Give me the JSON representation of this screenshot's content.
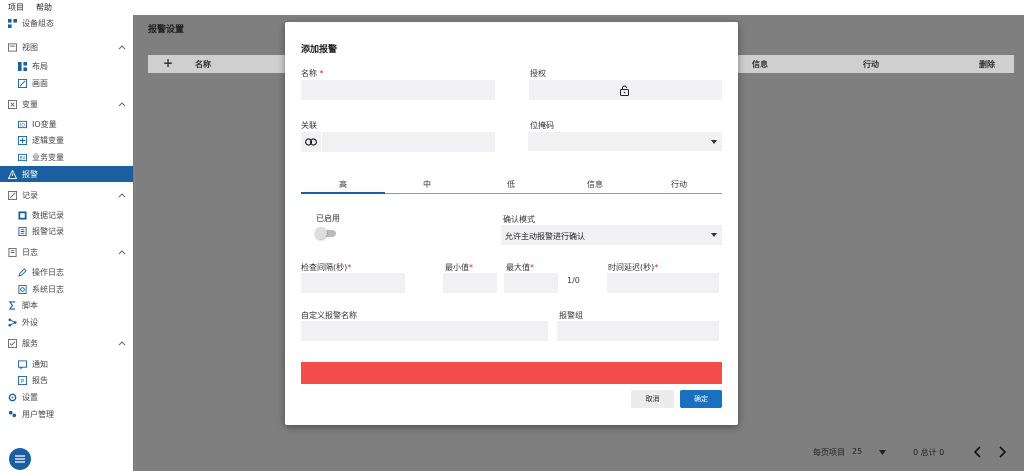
{
  "menubar": {
    "items": [
      "项目",
      "帮助"
    ]
  },
  "sidebar": {
    "device_config": "设备组态",
    "view": "视图",
    "layout": "布局",
    "canvas": "画面",
    "variables": "变量",
    "io_vars": "IO变量",
    "logic_vars": "逻辑变量",
    "business_vars": "业务变量",
    "alarm": "报警",
    "records": "记录",
    "data_records": "数据记录",
    "alarm_records": "报警记录",
    "logs": "日志",
    "op_logs": "操作日志",
    "sys_logs": "系统日志",
    "script": "脚本",
    "peripherals": "外设",
    "services": "服务",
    "notify": "通知",
    "report": "报告",
    "settings": "设置",
    "user_mgmt": "用户管理"
  },
  "main": {
    "title": "报警设置",
    "add_glyph": "+",
    "columns": [
      "名称",
      "信息",
      "行动",
      "删除"
    ],
    "per_page_label": "每页项目",
    "per_page_value": "25",
    "range": "0 总计 0"
  },
  "modal": {
    "title": "添加报警",
    "name_label": "名称",
    "required_mark": "*",
    "auth_label": "授权",
    "link_label": "关联",
    "bitmask_label": "位掩码",
    "tabs": [
      "高",
      "中",
      "低",
      "信息",
      "行动"
    ],
    "enabled_label": "已启用",
    "ack_mode_label": "确认模式",
    "ack_mode_value": "允许主动报警进行确认",
    "interval_label": "检查间隔(秒)",
    "min_label": "最小值",
    "max_label": "最大值",
    "ratio": "1/0",
    "delay_label": "时间延迟(秒)",
    "custom_name_label": "自定义报警名称",
    "group_label": "报警组",
    "cancel": "取消",
    "ok": "确定"
  },
  "colors": {
    "accent": "#1a5fa0",
    "error": "#f54c4c",
    "ok_button": "#1a6fbf"
  }
}
